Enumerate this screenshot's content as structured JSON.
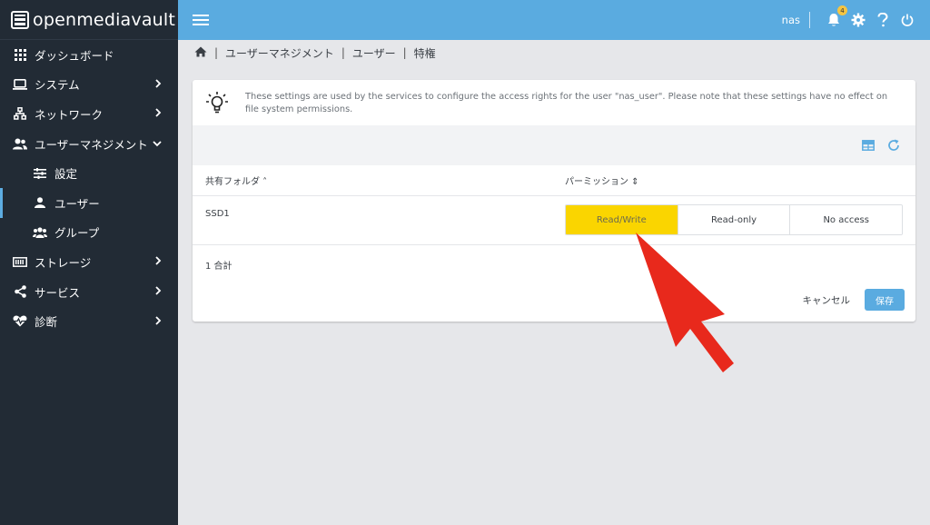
{
  "app": {
    "logo_text": "openmediavault"
  },
  "sidebar": {
    "items": [
      {
        "label": "ダッシュボード",
        "icon": "grid-icon",
        "chevron": ""
      },
      {
        "label": "システム",
        "icon": "laptop-icon",
        "chevron": "›"
      },
      {
        "label": "ネットワーク",
        "icon": "network-icon",
        "chevron": "›"
      },
      {
        "label": "ユーザーマネジメント",
        "icon": "users-icon",
        "chevron": "⌄"
      },
      {
        "label": "設定",
        "icon": "sliders-icon",
        "chevron": ""
      },
      {
        "label": "ユーザー",
        "icon": "user-icon",
        "chevron": ""
      },
      {
        "label": "グループ",
        "icon": "group-icon",
        "chevron": ""
      },
      {
        "label": "ストレージ",
        "icon": "storage-icon",
        "chevron": "›"
      },
      {
        "label": "サービス",
        "icon": "share-icon",
        "chevron": "›"
      },
      {
        "label": "診断",
        "icon": "heartbeat-icon",
        "chevron": "›"
      }
    ]
  },
  "topbar": {
    "user": "nas",
    "notification_count": "4"
  },
  "breadcrumb": {
    "items": [
      "ユーザーマネジメント",
      "ユーザー",
      "特権"
    ]
  },
  "info": {
    "text": "These settings are used by the services to configure the access rights for the user \"nas_user\". Please note that these settings have no effect on file system permissions."
  },
  "table": {
    "col_folder": "共有フォルダ ˄",
    "col_permission": "パーミッション ⇕",
    "rows": [
      {
        "folder": "SSD1",
        "options": [
          "Read/Write",
          "Read-only",
          "No access"
        ],
        "selected": "Read/Write"
      }
    ],
    "total": "1 合計"
  },
  "actions": {
    "cancel": "キャンセル",
    "save": "保存"
  },
  "colors": {
    "accent": "#5aabe0",
    "sidebar": "#222b35",
    "selected": "#fad500",
    "arrow": "#e8291c"
  }
}
